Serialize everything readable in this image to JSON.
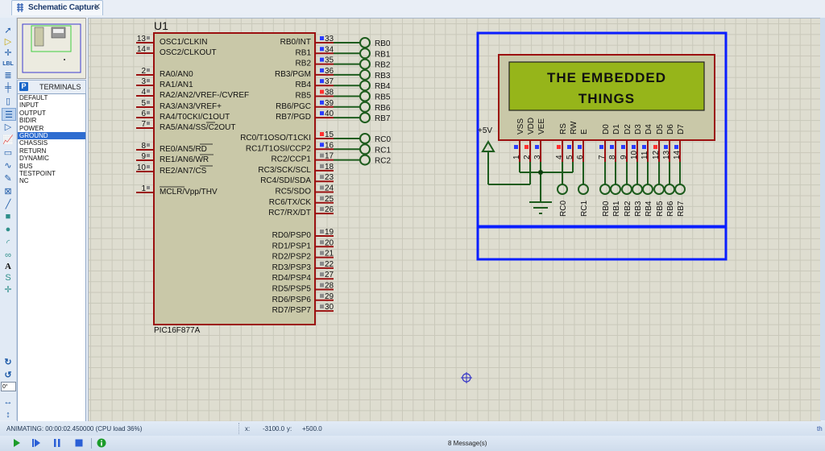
{
  "tab": {
    "label": "Schematic Capture",
    "close": "✕"
  },
  "left_toolbar": {
    "tools": [
      {
        "name": "selection-mode-icon",
        "glyph": "➚"
      },
      {
        "name": "component-mode-icon",
        "glyph": "▷"
      },
      {
        "name": "junction-dot-icon",
        "glyph": "✛"
      },
      {
        "name": "wire-label-icon",
        "glyph": "LBL"
      },
      {
        "name": "text-script-icon",
        "glyph": "≣"
      },
      {
        "name": "buses-icon",
        "glyph": "╪"
      },
      {
        "name": "subcircuit-icon",
        "glyph": "▯"
      },
      {
        "name": "terminals-mode-icon",
        "glyph": "☰"
      },
      {
        "name": "device-pins-icon",
        "glyph": "▷"
      },
      {
        "name": "graph-mode-icon",
        "glyph": "📈"
      },
      {
        "name": "tape-recorder-icon",
        "glyph": "▭"
      },
      {
        "name": "generator-icon",
        "glyph": "∿"
      },
      {
        "name": "voltage-probe-icon",
        "glyph": "✎"
      },
      {
        "name": "virtual-instruments-icon",
        "glyph": "⊠"
      },
      {
        "name": "line-icon",
        "glyph": "╱"
      },
      {
        "name": "box-icon",
        "glyph": "■"
      },
      {
        "name": "circle-icon",
        "glyph": "●"
      },
      {
        "name": "arc-icon",
        "glyph": "◜"
      },
      {
        "name": "path-icon",
        "glyph": "∞"
      },
      {
        "name": "text-icon",
        "glyph": "A"
      },
      {
        "name": "symbol-icon",
        "glyph": "S"
      },
      {
        "name": "marker-icon",
        "glyph": "✛"
      }
    ],
    "rotate_cw": "↻",
    "rotate_ccw": "↺",
    "angle_value": "0°",
    "mirror_x": "↔",
    "mirror_y": "↕"
  },
  "terminals_panel": {
    "mode_letter": "P",
    "title": "TERMINALS",
    "items": [
      "DEFAULT",
      "INPUT",
      "OUTPUT",
      "BIDIR",
      "POWER",
      "GROUND",
      "CHASSIS",
      "RETURN",
      "DYNAMIC",
      "BUS",
      "TESTPOINT",
      "NC"
    ],
    "selected": "GROUND"
  },
  "schematic": {
    "mcu": {
      "ref": "U1",
      "part": "PIC16F877A",
      "left_pins": [
        {
          "num": "13",
          "label": "OSC1/CLKIN"
        },
        {
          "num": "14",
          "label": "OSC2/CLKOUT"
        },
        {
          "num": "2",
          "label": "RA0/AN0"
        },
        {
          "num": "3",
          "label": "RA1/AN1"
        },
        {
          "num": "4",
          "label": "RA2/AN2/VREF-/CVREF"
        },
        {
          "num": "5",
          "label": "RA3/AN3/VREF+"
        },
        {
          "num": "6",
          "label": "RA4/T0CKI/C1OUT"
        },
        {
          "num": "7",
          "label": "RA5/AN4/SS/C2OUT"
        },
        {
          "num": "8",
          "label": "RE0/AN5/RD"
        },
        {
          "num": "9",
          "label": "RE1/AN6/WR"
        },
        {
          "num": "10",
          "label": "RE2/AN7/CS"
        },
        {
          "num": "1",
          "label": "MCLR/Vpp/THV"
        }
      ],
      "right_pins": [
        {
          "num": "33",
          "label": "RB0/INT",
          "state": "low"
        },
        {
          "num": "34",
          "label": "RB1",
          "state": "low"
        },
        {
          "num": "35",
          "label": "RB2",
          "state": "low"
        },
        {
          "num": "36",
          "label": "RB3/PGM",
          "state": "low"
        },
        {
          "num": "37",
          "label": "RB4",
          "state": "low"
        },
        {
          "num": "38",
          "label": "RB5",
          "state": "high"
        },
        {
          "num": "39",
          "label": "RB6/PGC",
          "state": "low"
        },
        {
          "num": "40",
          "label": "RB7/PGD",
          "state": "low"
        },
        {
          "num": "15",
          "label": "RC0/T1OSO/T1CKI",
          "state": "high"
        },
        {
          "num": "16",
          "label": "RC1/T1OSI/CCP2",
          "state": "low"
        },
        {
          "num": "17",
          "label": "RC2/CCP1",
          "state": "none"
        },
        {
          "num": "18",
          "label": "RC3/SCK/SCL",
          "state": "none"
        },
        {
          "num": "23",
          "label": "RC4/SDI/SDA",
          "state": "none"
        },
        {
          "num": "24",
          "label": "RC5/SDO",
          "state": "none"
        },
        {
          "num": "25",
          "label": "RC6/TX/CK",
          "state": "none"
        },
        {
          "num": "26",
          "label": "RC7/RX/DT",
          "state": "none"
        },
        {
          "num": "19",
          "label": "RD0/PSP0",
          "state": "none"
        },
        {
          "num": "20",
          "label": "RD1/PSP1",
          "state": "none"
        },
        {
          "num": "21",
          "label": "RD2/PSP2",
          "state": "none"
        },
        {
          "num": "22",
          "label": "RD3/PSP3",
          "state": "none"
        },
        {
          "num": "27",
          "label": "RD4/PSP4",
          "state": "none"
        },
        {
          "num": "28",
          "label": "RD5/PSP5",
          "state": "none"
        },
        {
          "num": "29",
          "label": "RD6/PSP6",
          "state": "none"
        },
        {
          "num": "30",
          "label": "RD7/PSP7",
          "state": "none"
        }
      ],
      "terminals": [
        "RB0",
        "RB1",
        "RB2",
        "RB3",
        "RB4",
        "RB5",
        "RB6",
        "RB7",
        "RC0",
        "RC1",
        "RC2"
      ]
    },
    "lcd": {
      "line1": "THE EMBEDDED",
      "line2": "THINGS",
      "power_label": "+5V",
      "pins": [
        {
          "num": "1",
          "label": "VSS",
          "state": "low"
        },
        {
          "num": "2",
          "label": "VDD",
          "state": "high"
        },
        {
          "num": "3",
          "label": "VEE",
          "state": "low"
        },
        {
          "num": "4",
          "label": "RS",
          "state": "high"
        },
        {
          "num": "5",
          "label": "RW",
          "state": "low"
        },
        {
          "num": "6",
          "label": "E",
          "state": "low"
        },
        {
          "num": "7",
          "label": "D0",
          "state": "low"
        },
        {
          "num": "8",
          "label": "D1",
          "state": "low"
        },
        {
          "num": "9",
          "label": "D2",
          "state": "low"
        },
        {
          "num": "10",
          "label": "D3",
          "state": "low"
        },
        {
          "num": "11",
          "label": "D4",
          "state": "low"
        },
        {
          "num": "12",
          "label": "D5",
          "state": "high"
        },
        {
          "num": "13",
          "label": "D6",
          "state": "low"
        },
        {
          "num": "14",
          "label": "D7",
          "state": "low"
        }
      ],
      "terminals": [
        "RC0",
        "RC1",
        "RB0",
        "RB1",
        "RB2",
        "RB3",
        "RB4",
        "RB5",
        "RB6",
        "RB7"
      ]
    }
  },
  "status": {
    "animating": "ANIMATING: 00:00:02.450000 (CPU load 36%)",
    "x_label": "x:",
    "x_value": "-3100.0",
    "y_label": "y:",
    "y_value": "+500.0",
    "right_text": "th"
  },
  "simulation": {
    "play": "Play",
    "step": "Step",
    "pause": "Pause",
    "stop": "Stop",
    "messages": "8 Message(s)"
  },
  "colors": {
    "wire": "#1d5c1d",
    "pin": "#9b1010",
    "logic_high": "#ff3030",
    "logic_low": "#2a3cff",
    "selection_box": "#0a1eff",
    "lcd_screen": "#96b51a",
    "chip_body": "#c9c8a8"
  }
}
